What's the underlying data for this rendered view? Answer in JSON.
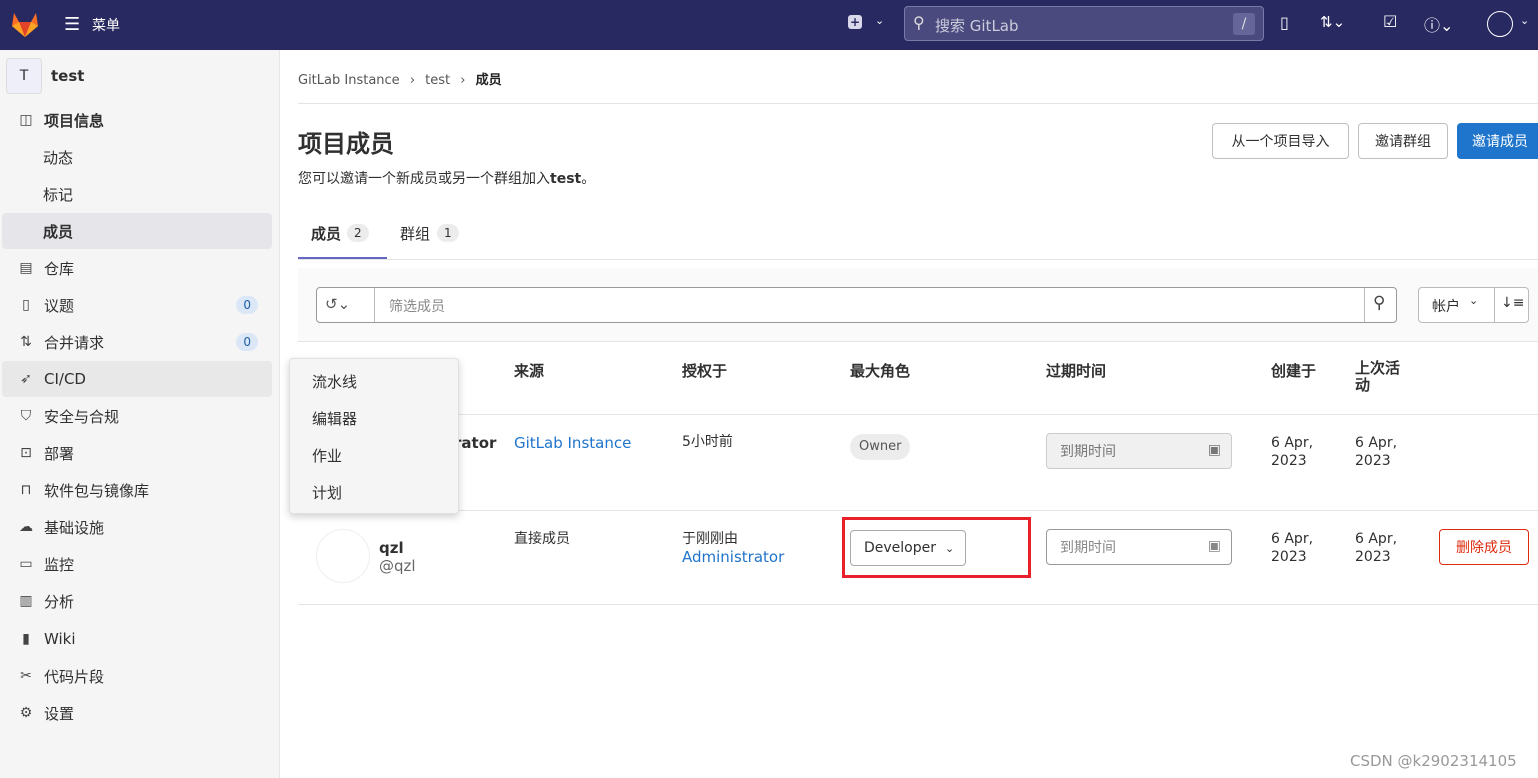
{
  "topbar": {
    "menu_label": "菜单",
    "search_placeholder": "搜索 GitLab",
    "search_shortcut": "/"
  },
  "sidebar": {
    "project_initial": "T",
    "project_name": "test",
    "items": [
      {
        "label": "项目信息",
        "icon": "info-icon"
      },
      {
        "label": "动态"
      },
      {
        "label": "标记"
      },
      {
        "label": "成员",
        "active": true
      },
      {
        "label": "仓库",
        "icon": "doc-icon"
      },
      {
        "label": "议题",
        "icon": "issues-icon",
        "badge": "0"
      },
      {
        "label": "合并请求",
        "icon": "merge-request-icon",
        "badge": "0"
      },
      {
        "label": "CI/CD",
        "icon": "rocket-icon"
      },
      {
        "label": "安全与合规",
        "icon": "shield-icon"
      },
      {
        "label": "部署",
        "icon": "deploy-icon"
      },
      {
        "label": "软件包与镜像库",
        "icon": "package-icon"
      },
      {
        "label": "基础设施",
        "icon": "cloud-icon"
      },
      {
        "label": "监控",
        "icon": "monitor-icon"
      },
      {
        "label": "分析",
        "icon": "chart-icon"
      },
      {
        "label": "Wiki",
        "icon": "book-icon"
      },
      {
        "label": "代码片段",
        "icon": "snippet-icon"
      },
      {
        "label": "设置",
        "icon": "gear-icon"
      }
    ],
    "cicd_flyout": [
      "流水线",
      "编辑器",
      "作业",
      "计划"
    ]
  },
  "breadcrumb": [
    "GitLab Instance",
    "test",
    "成员"
  ],
  "page": {
    "title": "项目成员",
    "desc_prefix": "您可以邀请一个新成员或另一个群组加入",
    "desc_project": "test",
    "desc_suffix": "。",
    "buttons": {
      "import": "从一个项目导入",
      "invite_group": "邀请群组",
      "invite_member": "邀请成员"
    }
  },
  "tabs": [
    {
      "label": "成员",
      "count": "2"
    },
    {
      "label": "群组",
      "count": "1"
    }
  ],
  "filter": {
    "placeholder": "筛选成员",
    "sort_label": "帐户"
  },
  "table": {
    "headers": [
      "来源",
      "授权于",
      "最大角色",
      "过期时间",
      "创建于",
      "上次活动"
    ],
    "rows": [
      {
        "name": "Administrator",
        "source": "GitLab Instance",
        "granted": "5小时前",
        "role": "Owner",
        "expiry_placeholder": "到期时间",
        "created": "6 Apr, 2023",
        "last": "6 Apr, 2023"
      },
      {
        "name": "qzl",
        "username": "@qzl",
        "source": "直接成员",
        "granted_prefix": "于刚刚由",
        "granted_by": "Administrator",
        "role": "Developer",
        "expiry_placeholder": "到期时间",
        "created": "6 Apr, 2023",
        "last": "6 Apr, 2023",
        "action": "删除成员"
      }
    ]
  },
  "watermark": "CSDN @k2902314105",
  "colors": {
    "topbar": "#292961",
    "primary": "#1f75cb",
    "danger": "#dd2b0e",
    "highlight": "#e8202a"
  }
}
